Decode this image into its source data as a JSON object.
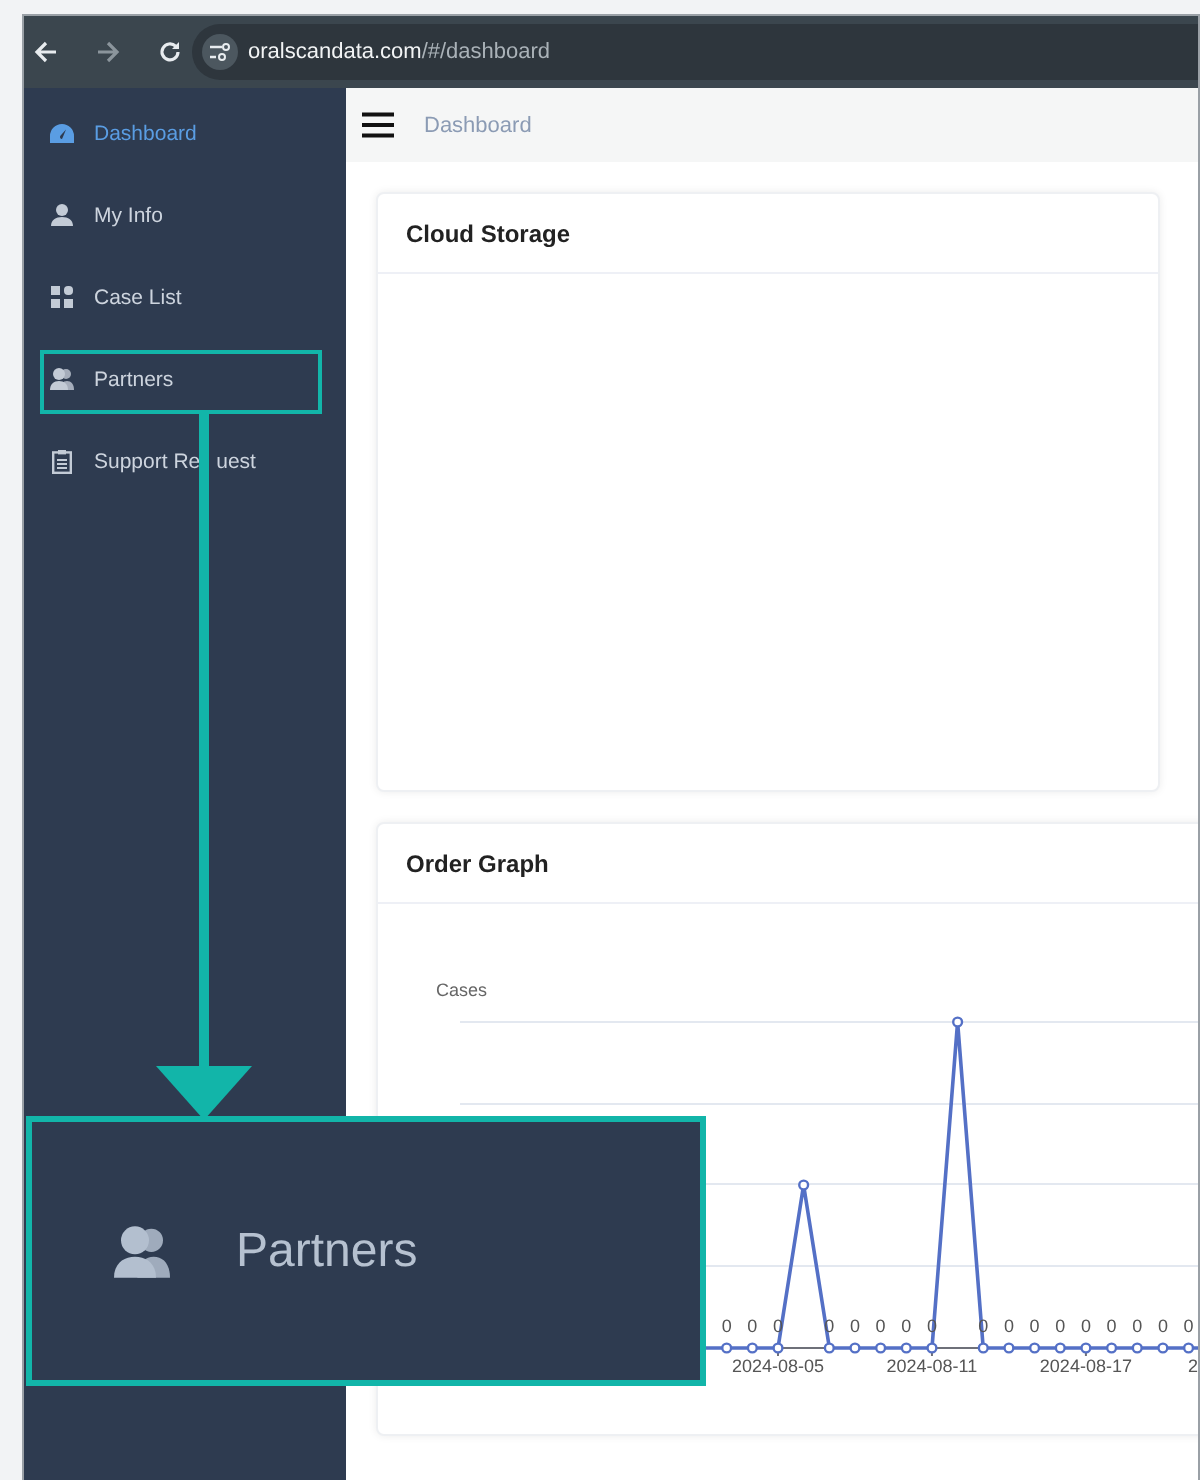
{
  "browser": {
    "url_host": "oralscandata.com",
    "url_path": "/#/dashboard"
  },
  "sidebar": {
    "items": [
      {
        "label": "Dashboard",
        "selected": true
      },
      {
        "label": "My Info",
        "selected": false
      },
      {
        "label": "Case List",
        "selected": false
      },
      {
        "label": "Partners",
        "selected": false
      },
      {
        "label": "Support Re",
        "label_after_cover": "uest",
        "selected": false
      }
    ]
  },
  "header": {
    "breadcrumb": "Dashboard"
  },
  "cloud_storage": {
    "title": "Cloud Storage"
  },
  "order_graph": {
    "title": "Order Graph",
    "y_axis_label": "Cases",
    "x_labels": [
      "2024-08-05",
      "2024-08-11",
      "2024-08-17",
      "2"
    ],
    "point_labels": [
      "0",
      "0",
      "0",
      "0",
      "0",
      "0",
      "0",
      "0",
      "0",
      "0",
      "0",
      "0",
      "0",
      "0",
      "0",
      "0",
      "0"
    ]
  },
  "callout": {
    "label": "Partners"
  }
}
